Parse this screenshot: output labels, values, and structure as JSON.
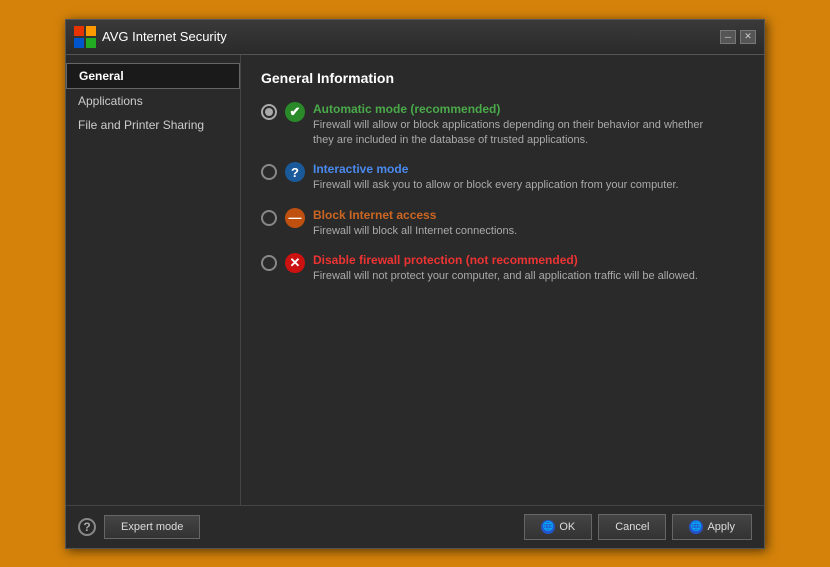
{
  "window": {
    "title": "AVG Internet Security",
    "minimize_label": "─",
    "close_label": "✕"
  },
  "sidebar": {
    "items": [
      {
        "id": "general",
        "label": "General",
        "active": true
      },
      {
        "id": "applications",
        "label": "Applications",
        "active": false
      },
      {
        "id": "file-printer",
        "label": "File and Printer Sharing",
        "active": false
      }
    ]
  },
  "main": {
    "section_title": "General Information",
    "options": [
      {
        "id": "automatic",
        "selected": true,
        "icon": "✔",
        "icon_class": "icon-green",
        "title_class": "option-title-green",
        "title": "Automatic mode (recommended)",
        "desc": "Firewall will allow or block applications depending on their behavior and whether\nthey are included in the database of trusted applications."
      },
      {
        "id": "interactive",
        "selected": false,
        "icon": "?",
        "icon_class": "icon-blue",
        "title_class": "option-title-blue",
        "title": "Interactive mode",
        "desc": "Firewall will ask you to allow or block every application from your computer."
      },
      {
        "id": "block",
        "selected": false,
        "icon": "—",
        "icon_class": "icon-orange",
        "title_class": "option-title-orange",
        "title": "Block Internet access",
        "desc": "Firewall will block all Internet connections."
      },
      {
        "id": "disable",
        "selected": false,
        "icon": "✕",
        "icon_class": "icon-red",
        "title_class": "option-title-red",
        "title": "Disable firewall protection (not recommended)",
        "desc": "Firewall will not protect your computer, and all application traffic will be allowed."
      }
    ]
  },
  "footer": {
    "help_label": "?",
    "expert_mode_label": "Expert mode",
    "ok_label": "OK",
    "cancel_label": "Cancel",
    "apply_label": "Apply"
  }
}
